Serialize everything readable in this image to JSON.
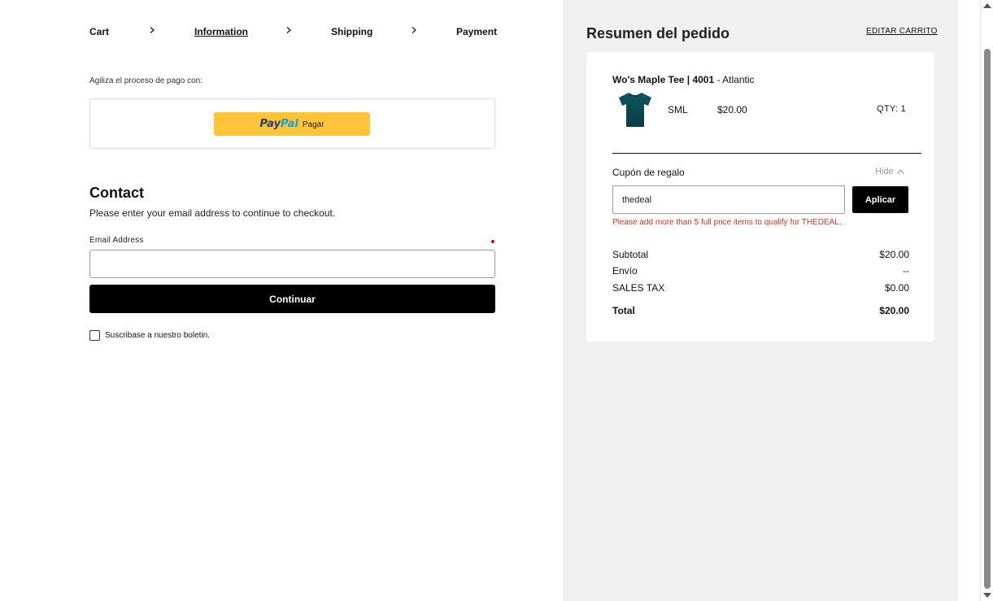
{
  "breadcrumb": {
    "steps": [
      "Cart",
      "Information",
      "Shipping",
      "Payment"
    ]
  },
  "express": {
    "label": "Agiliza el proceso de pago con:",
    "paypal_logo_a": "Pay",
    "paypal_logo_b": "Pal",
    "paypal_text": "Pagar",
    "paypal_color": "#ffc439"
  },
  "contact": {
    "title": "Contact",
    "subtitle": "Please enter your email address to continue to checkout.",
    "email_label": "Email Address",
    "email_value": "",
    "continue_label": "Continuar",
    "newsletter_label": "Suscribase a nuestro boletin."
  },
  "summary": {
    "title": "Resumen del pedido",
    "edit_cart": "EDITAR CARRITO",
    "product": {
      "name": "Wo's Maple Tee | 4001",
      "variant": " - Atlantic",
      "size": "SML",
      "price": "$20.00",
      "qty": "QTY: 1",
      "image_icon": "tshirt-icon",
      "image_color": "#0e4a52"
    },
    "coupon": {
      "title": "Cupón de regalo",
      "hide_label": "Hide",
      "value": "thedeal",
      "apply_label": "Aplicar",
      "error": "Please add more than 5 full price items to qualify for THEDEAL.",
      "error_color": "#c0392b"
    },
    "totals": [
      {
        "label": "Subtotal",
        "value": "$20.00"
      },
      {
        "label": "Envío",
        "value": "--"
      },
      {
        "label": "SALES TAX",
        "value": "$0.00"
      },
      {
        "label": "Total",
        "value": "$20.00"
      }
    ]
  }
}
